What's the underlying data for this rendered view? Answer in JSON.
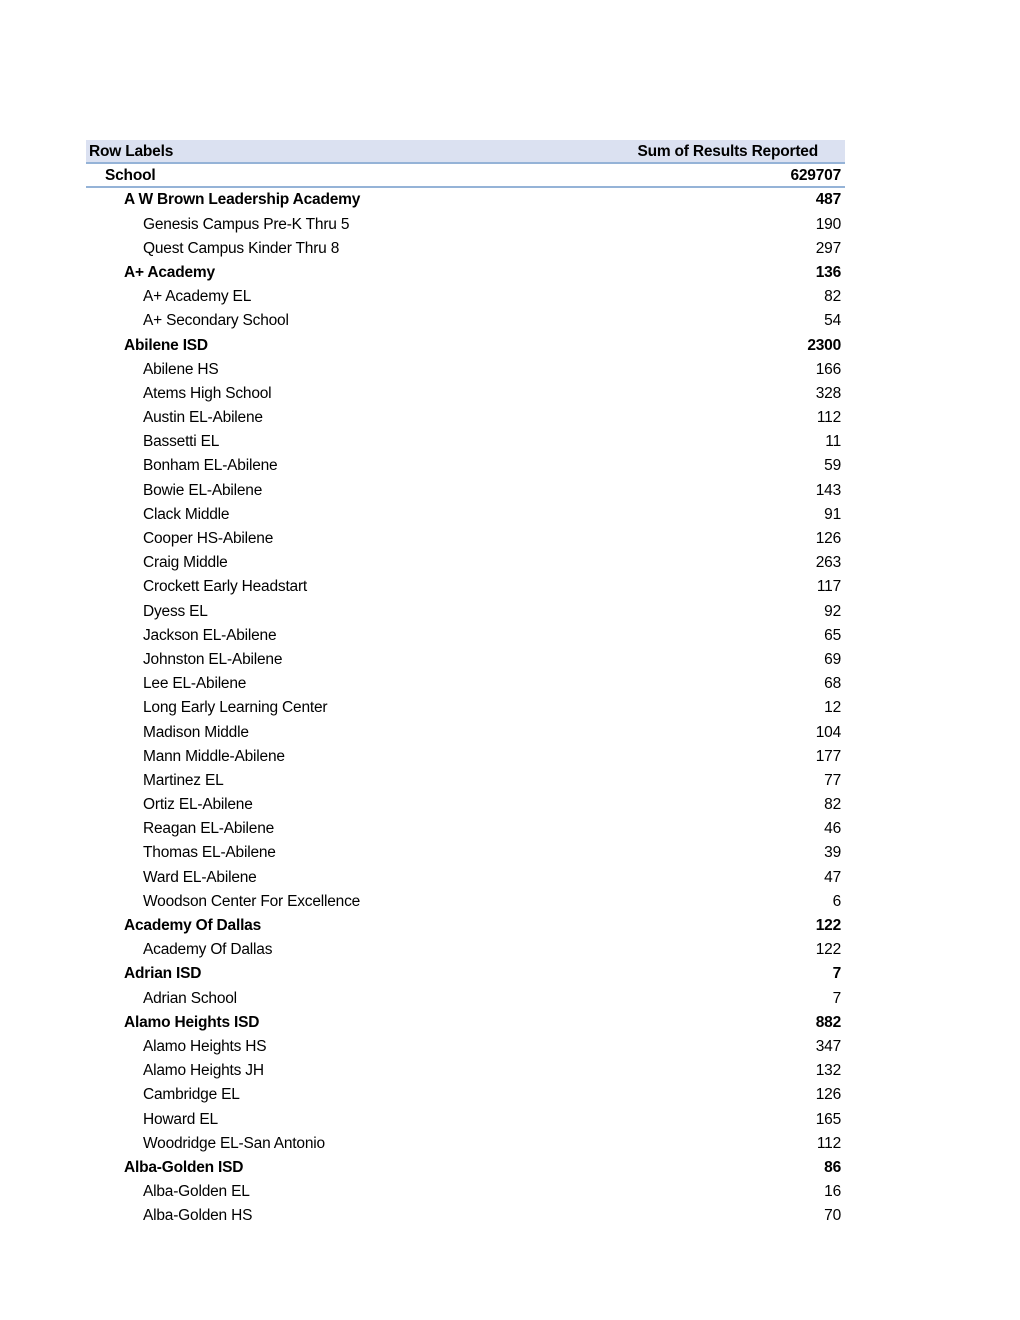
{
  "pivot": {
    "header": {
      "row_labels": "Row Labels",
      "value_header": "Sum of Results Reported"
    },
    "root": {
      "label": "School",
      "value": "629707"
    },
    "rows": [
      {
        "level": 1,
        "label": "A W Brown Leadership Academy",
        "value": "487"
      },
      {
        "level": 2,
        "label": "Genesis Campus Pre-K Thru 5",
        "value": "190"
      },
      {
        "level": 2,
        "label": "Quest Campus Kinder Thru 8",
        "value": "297"
      },
      {
        "level": 1,
        "label": "A+ Academy",
        "value": "136"
      },
      {
        "level": 2,
        "label": "A+ Academy EL",
        "value": "82"
      },
      {
        "level": 2,
        "label": "A+ Secondary School",
        "value": "54"
      },
      {
        "level": 1,
        "label": "Abilene ISD",
        "value": "2300"
      },
      {
        "level": 2,
        "label": "Abilene HS",
        "value": "166"
      },
      {
        "level": 2,
        "label": "Atems High School",
        "value": "328"
      },
      {
        "level": 2,
        "label": "Austin EL-Abilene",
        "value": "112"
      },
      {
        "level": 2,
        "label": "Bassetti EL",
        "value": "11"
      },
      {
        "level": 2,
        "label": "Bonham EL-Abilene",
        "value": "59"
      },
      {
        "level": 2,
        "label": "Bowie EL-Abilene",
        "value": "143"
      },
      {
        "level": 2,
        "label": "Clack Middle",
        "value": "91"
      },
      {
        "level": 2,
        "label": "Cooper HS-Abilene",
        "value": "126"
      },
      {
        "level": 2,
        "label": "Craig Middle",
        "value": "263"
      },
      {
        "level": 2,
        "label": "Crockett Early Headstart",
        "value": "117"
      },
      {
        "level": 2,
        "label": "Dyess EL",
        "value": "92"
      },
      {
        "level": 2,
        "label": "Jackson EL-Abilene",
        "value": "65"
      },
      {
        "level": 2,
        "label": "Johnston EL-Abilene",
        "value": "69"
      },
      {
        "level": 2,
        "label": "Lee EL-Abilene",
        "value": "68"
      },
      {
        "level": 2,
        "label": "Long Early Learning Center",
        "value": "12"
      },
      {
        "level": 2,
        "label": "Madison Middle",
        "value": "104"
      },
      {
        "level": 2,
        "label": "Mann Middle-Abilene",
        "value": "177"
      },
      {
        "level": 2,
        "label": "Martinez EL",
        "value": "77"
      },
      {
        "level": 2,
        "label": "Ortiz EL-Abilene",
        "value": "82"
      },
      {
        "level": 2,
        "label": "Reagan EL-Abilene",
        "value": "46"
      },
      {
        "level": 2,
        "label": "Thomas EL-Abilene",
        "value": "39"
      },
      {
        "level": 2,
        "label": "Ward EL-Abilene",
        "value": "47"
      },
      {
        "level": 2,
        "label": "Woodson Center For Excellence",
        "value": "6"
      },
      {
        "level": 1,
        "label": "Academy Of Dallas",
        "value": "122"
      },
      {
        "level": 2,
        "label": "Academy Of Dallas",
        "value": "122"
      },
      {
        "level": 1,
        "label": "Adrian ISD",
        "value": "7"
      },
      {
        "level": 2,
        "label": "Adrian School",
        "value": "7"
      },
      {
        "level": 1,
        "label": "Alamo Heights ISD",
        "value": "882"
      },
      {
        "level": 2,
        "label": "Alamo Heights HS",
        "value": "347"
      },
      {
        "level": 2,
        "label": "Alamo Heights JH",
        "value": "132"
      },
      {
        "level": 2,
        "label": "Cambridge EL",
        "value": "126"
      },
      {
        "level": 2,
        "label": "Howard EL",
        "value": "165"
      },
      {
        "level": 2,
        "label": "Woodridge EL-San Antonio",
        "value": "112"
      },
      {
        "level": 1,
        "label": "Alba-Golden ISD",
        "value": "86"
      },
      {
        "level": 2,
        "label": "Alba-Golden EL",
        "value": "16"
      },
      {
        "level": 2,
        "label": "Alba-Golden HS",
        "value": "70"
      }
    ]
  },
  "colors": {
    "header_fill": "#dbe1f1",
    "border": "#95b3d7"
  }
}
